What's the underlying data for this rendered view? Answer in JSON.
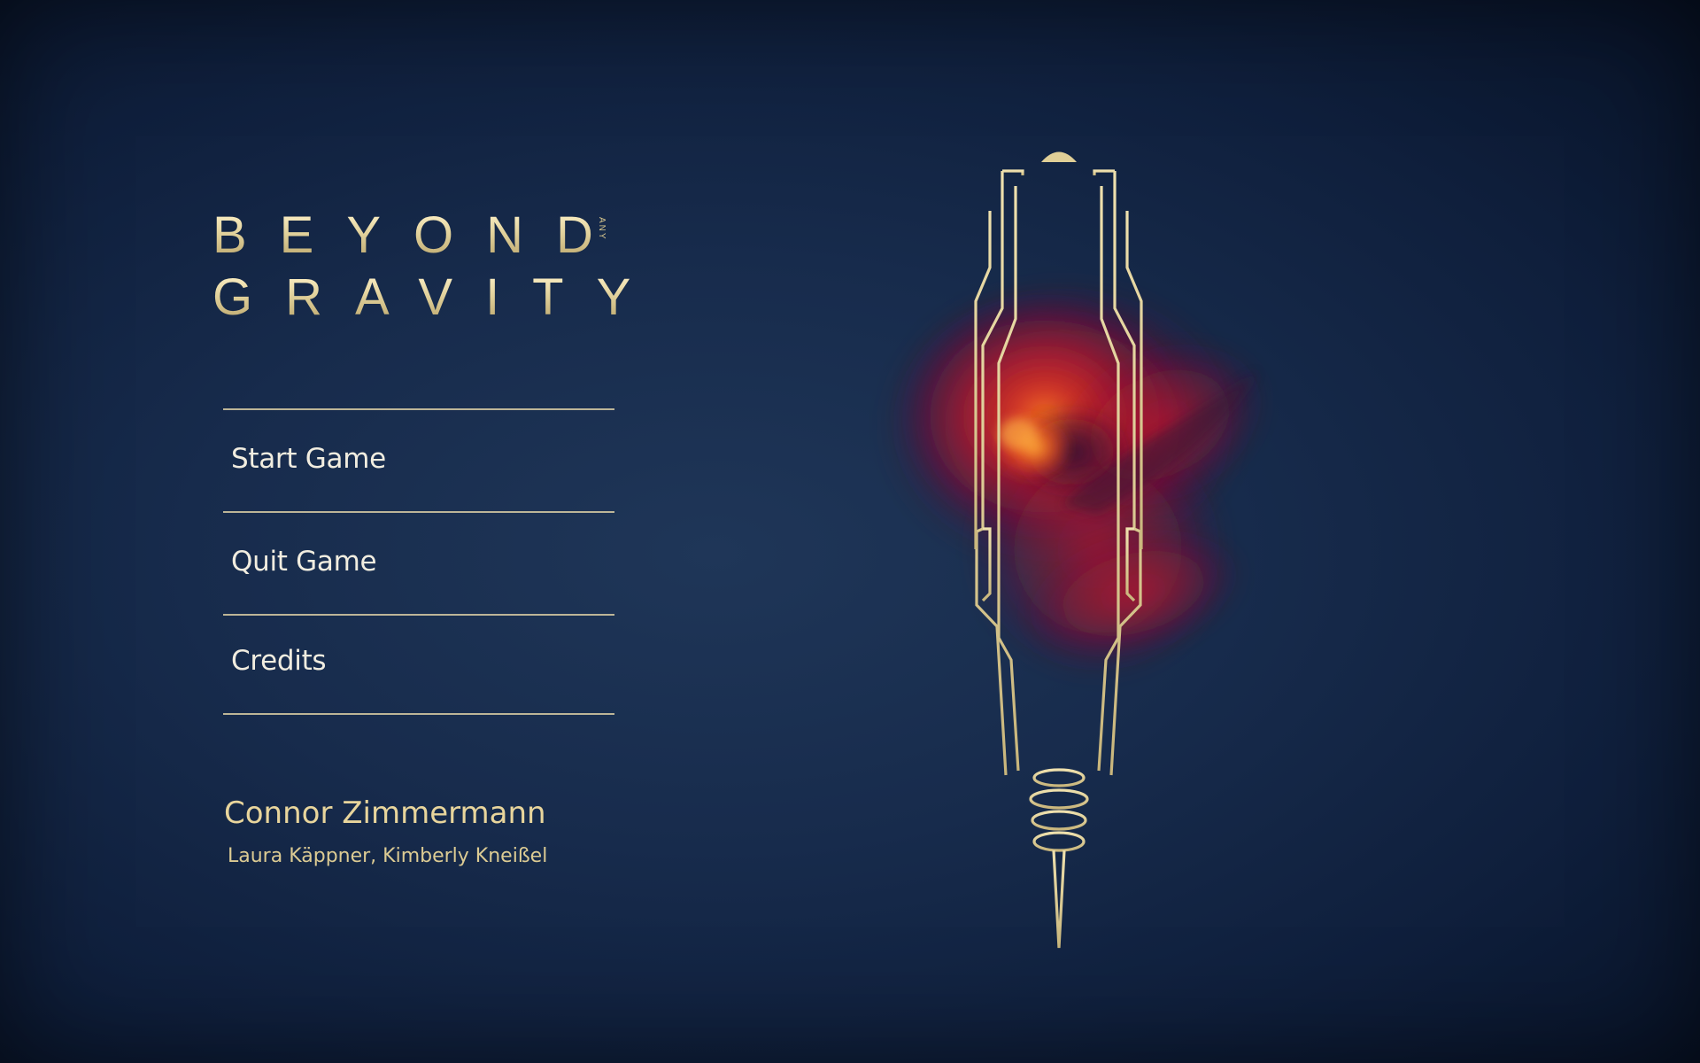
{
  "logo": {
    "line1": "BEYOND",
    "small_word": "ANY",
    "line2": "GRAVITY"
  },
  "menu": {
    "items": [
      {
        "label": "Start Game"
      },
      {
        "label": "Quit Game"
      },
      {
        "label": "Credits"
      }
    ]
  },
  "credits": {
    "main": "Connor Zimmermann",
    "sub": "Laura Käppner, Kimberly Kneißel"
  },
  "colors": {
    "background": "#172b4c",
    "gold": "#d8c78f",
    "menu_text": "#f1ede0",
    "nebula_red": "#c8202a",
    "nebula_core": "#ff7a1a"
  },
  "artwork": {
    "icon": "art-deco-spire-icon",
    "effect": "red-nebula-cloud"
  }
}
